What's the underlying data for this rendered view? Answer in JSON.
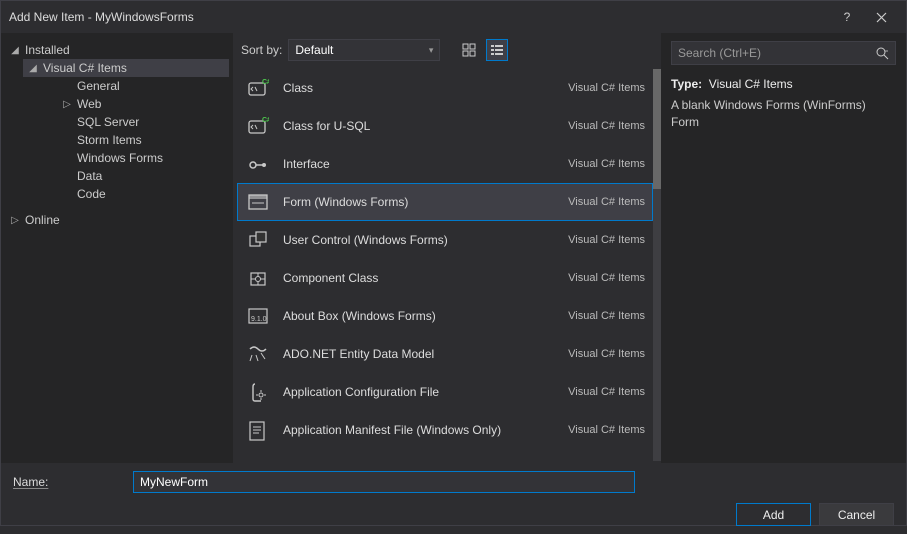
{
  "window": {
    "title": "Add New Item - MyWindowsForms"
  },
  "tree": {
    "installed": "Installed",
    "csharp": "Visual C# Items",
    "children": [
      "General",
      "Web",
      "SQL Server",
      "Storm Items",
      "Windows Forms",
      "Data",
      "Code"
    ],
    "online": "Online"
  },
  "sort": {
    "label": "Sort by:",
    "value": "Default"
  },
  "items": [
    {
      "name": "Class",
      "lang": "Visual C# Items",
      "icon": "class"
    },
    {
      "name": "Class for U-SQL",
      "lang": "Visual C# Items",
      "icon": "class"
    },
    {
      "name": "Interface",
      "lang": "Visual C# Items",
      "icon": "interface"
    },
    {
      "name": "Form (Windows Forms)",
      "lang": "Visual C# Items",
      "icon": "form",
      "selected": true
    },
    {
      "name": "User Control (Windows Forms)",
      "lang": "Visual C# Items",
      "icon": "usercontrol"
    },
    {
      "name": "Component Class",
      "lang": "Visual C# Items",
      "icon": "component"
    },
    {
      "name": "About Box (Windows Forms)",
      "lang": "Visual C# Items",
      "icon": "about"
    },
    {
      "name": "ADO.NET Entity Data Model",
      "lang": "Visual C# Items",
      "icon": "ado"
    },
    {
      "name": "Application Configuration File",
      "lang": "Visual C# Items",
      "icon": "config"
    },
    {
      "name": "Application Manifest File (Windows Only)",
      "lang": "Visual C# Items",
      "icon": "manifest"
    }
  ],
  "search": {
    "placeholder": "Search (Ctrl+E)"
  },
  "info": {
    "typeLabel": "Type:",
    "typeValue": "Visual C# Items",
    "desc": "A blank Windows Forms (WinForms) Form"
  },
  "name": {
    "label": "Name:",
    "value": "MyNewForm"
  },
  "buttons": {
    "add": "Add",
    "cancel": "Cancel"
  }
}
